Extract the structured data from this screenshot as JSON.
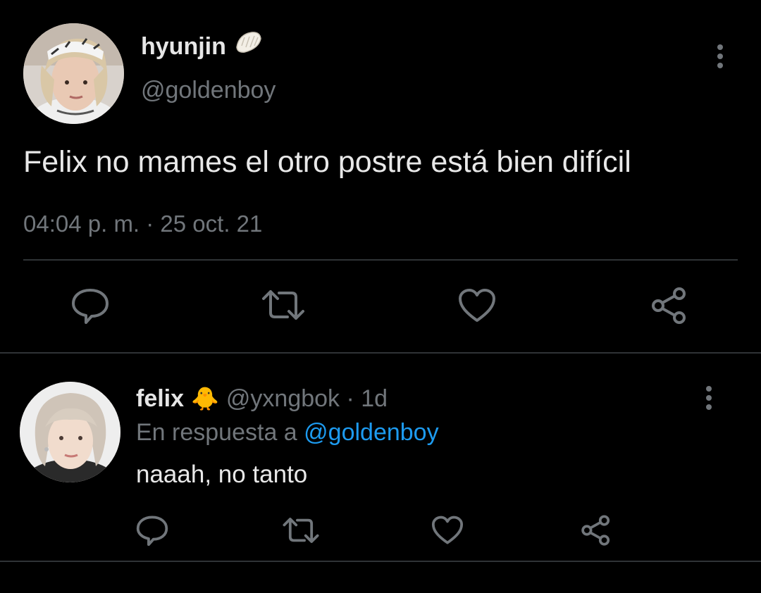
{
  "main_tweet": {
    "display_name": "hyunjin",
    "name_emoji": "dumpling-icon",
    "handle": "@goldenboy",
    "text": "Felix no mames el otro postre está bien difícil",
    "timestamp": "04:04 p. m. · 25 oct. 21",
    "actions": [
      "reply-icon",
      "retweet-icon",
      "like-icon",
      "share-icon"
    ]
  },
  "reply_tweet": {
    "display_name": "felix",
    "name_emoji": "🐥",
    "handle_time": "@yxngbok · 1d",
    "context_prefix": "En respuesta a ",
    "context_mention": "@goldenboy",
    "text": "naaah, no tanto",
    "actions": [
      "reply-icon",
      "retweet-icon",
      "like-icon",
      "share-icon"
    ]
  },
  "colors": {
    "background": "#000000",
    "primary_text": "#e8e8e8",
    "secondary_text": "#71767b",
    "link": "#1d9bf0",
    "divider": "#2f3336"
  }
}
